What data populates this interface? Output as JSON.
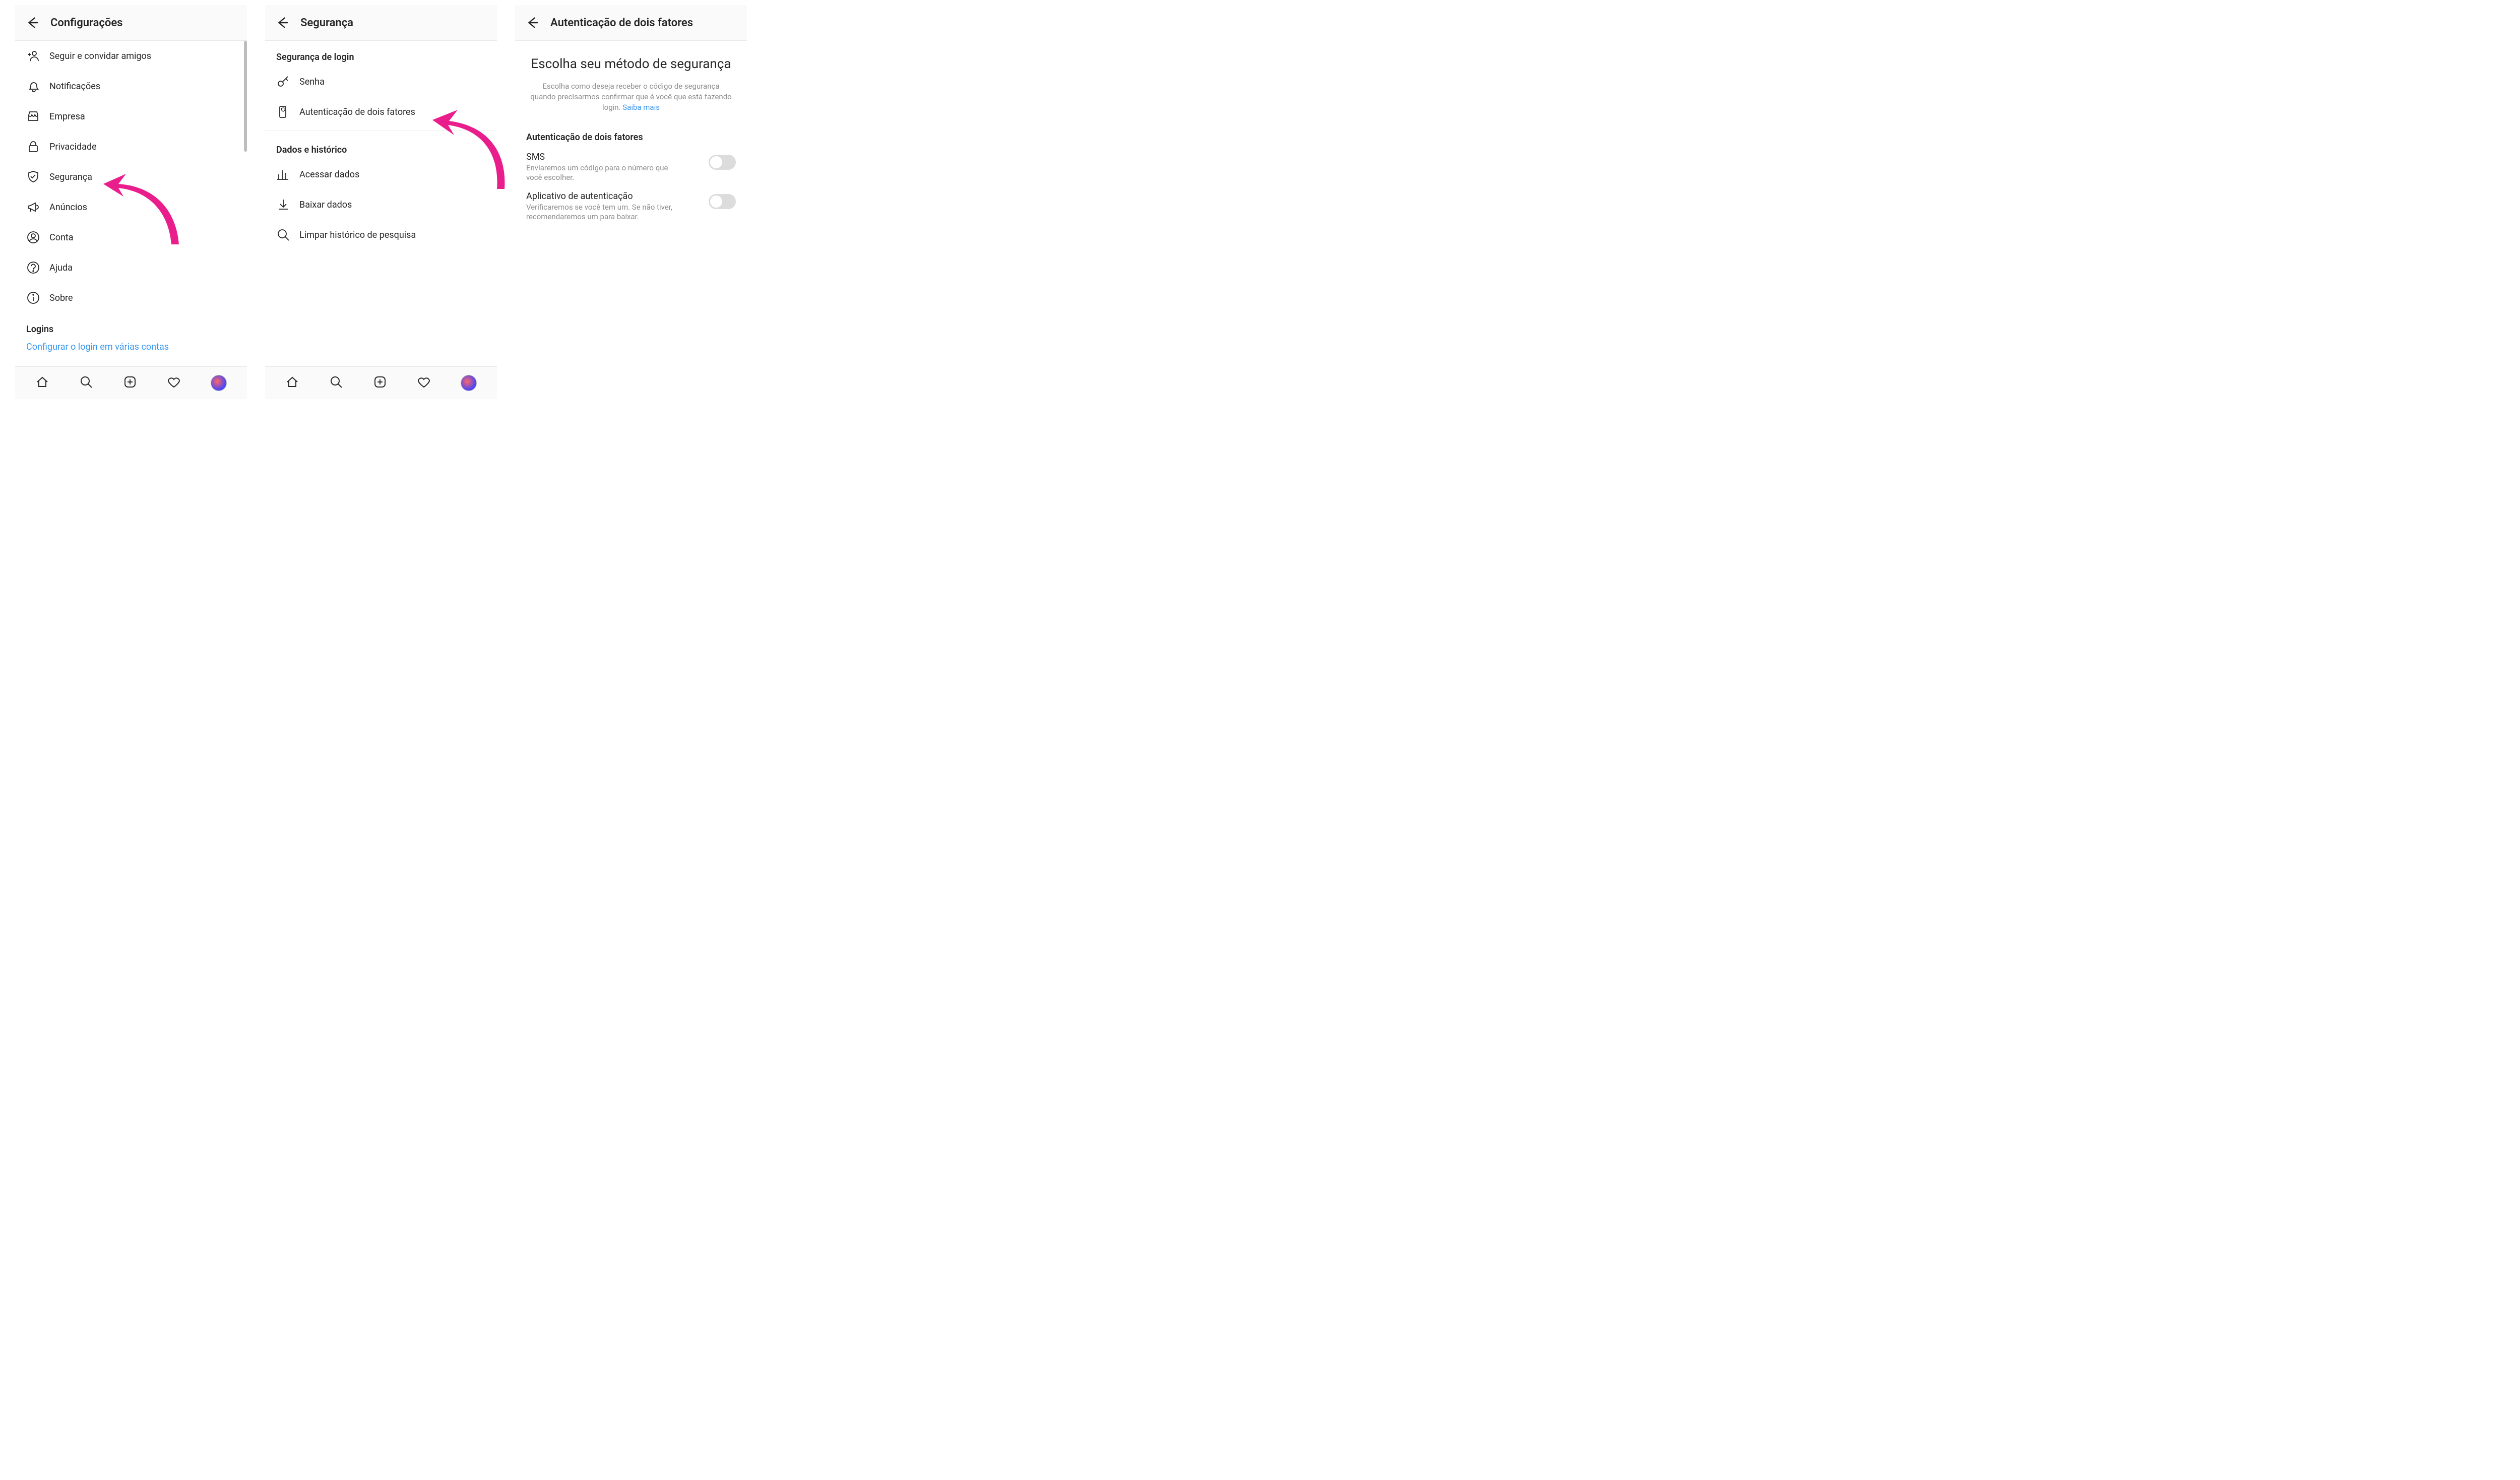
{
  "phone1": {
    "title": "Configurações",
    "items": [
      {
        "icon": "add-person",
        "label": "Seguir e convidar amigos"
      },
      {
        "icon": "bell",
        "label": "Notificações"
      },
      {
        "icon": "store",
        "label": "Empresa"
      },
      {
        "icon": "lock",
        "label": "Privacidade"
      },
      {
        "icon": "shield",
        "label": "Segurança"
      },
      {
        "icon": "megaphone",
        "label": "Anúncios"
      },
      {
        "icon": "user",
        "label": "Conta"
      },
      {
        "icon": "help",
        "label": "Ajuda"
      },
      {
        "icon": "info",
        "label": "Sobre"
      }
    ],
    "section": "Logins",
    "link": "Configurar o login em várias contas"
  },
  "phone2": {
    "title": "Segurança",
    "section1": "Segurança de login",
    "items1": [
      {
        "icon": "key",
        "label": "Senha"
      },
      {
        "icon": "phone-shield",
        "label": "Autenticação de dois fatores"
      }
    ],
    "section2": "Dados e histórico",
    "items2": [
      {
        "icon": "bars",
        "label": "Acessar dados"
      },
      {
        "icon": "download",
        "label": "Baixar dados"
      },
      {
        "icon": "search",
        "label": "Limpar histórico de pesquisa"
      }
    ]
  },
  "phone3": {
    "title": "Autenticação de dois fatores",
    "heading": "Escolha seu método de segurança",
    "subtitle": "Escolha como deseja receber o código de segurança quando precisarmos confirmar que é você que está fazendo login. ",
    "learn_more": "Saiba mais",
    "section": "Autenticação de dois fatores",
    "options": [
      {
        "title": "SMS",
        "desc": "Enviaremos um código para o número que você escolher."
      },
      {
        "title": "Aplicativo de autenticação",
        "desc": "Verificaremos se você tem um. Se não tiver, recomendaremos um para baixar."
      }
    ]
  }
}
